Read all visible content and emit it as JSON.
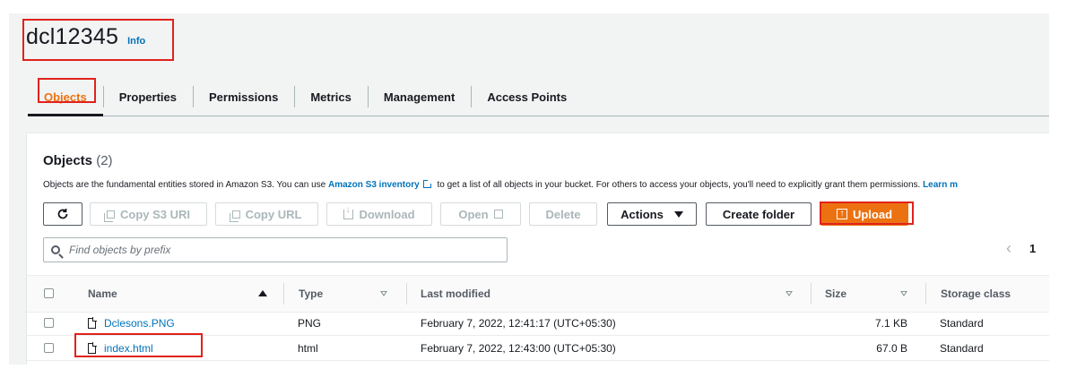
{
  "bucket": {
    "name": "dcl12345",
    "info_label": "Info"
  },
  "tabs": [
    {
      "label": "Objects",
      "active": true
    },
    {
      "label": "Properties"
    },
    {
      "label": "Permissions"
    },
    {
      "label": "Metrics"
    },
    {
      "label": "Management"
    },
    {
      "label": "Access Points"
    }
  ],
  "objects": {
    "heading": "Objects",
    "count": "(2)",
    "description_before": "Objects are the fundamental entities stored in Amazon S3. You can use",
    "description_link": "Amazon S3 inventory",
    "description_after": "to get a list of all objects in your bucket. For others to access your objects, you'll need to explicitly grant them permissions.",
    "learn_more": "Learn m"
  },
  "toolbar": {
    "copy_s3_uri": "Copy S3 URI",
    "copy_url": "Copy URL",
    "download": "Download",
    "open": "Open",
    "delete": "Delete",
    "actions": "Actions",
    "create_folder": "Create folder",
    "upload": "Upload"
  },
  "search": {
    "placeholder": "Find objects by prefix"
  },
  "pagination": {
    "page": "1"
  },
  "table": {
    "columns": [
      "Name",
      "Type",
      "Last modified",
      "Size",
      "Storage class"
    ],
    "rows": [
      {
        "name": "Dclesons.PNG",
        "type": "PNG",
        "last_modified": "February 7, 2022, 12:41:17 (UTC+05:30)",
        "size": "7.1 KB",
        "storage_class": "Standard"
      },
      {
        "name": "index.html",
        "type": "html",
        "last_modified": "February 7, 2022, 12:43:00 (UTC+05:30)",
        "size": "67.0 B",
        "storage_class": "Standard"
      }
    ]
  },
  "colors": {
    "accent": "#ec7211",
    "link": "#0073bb",
    "annotation": "#e0221c"
  }
}
